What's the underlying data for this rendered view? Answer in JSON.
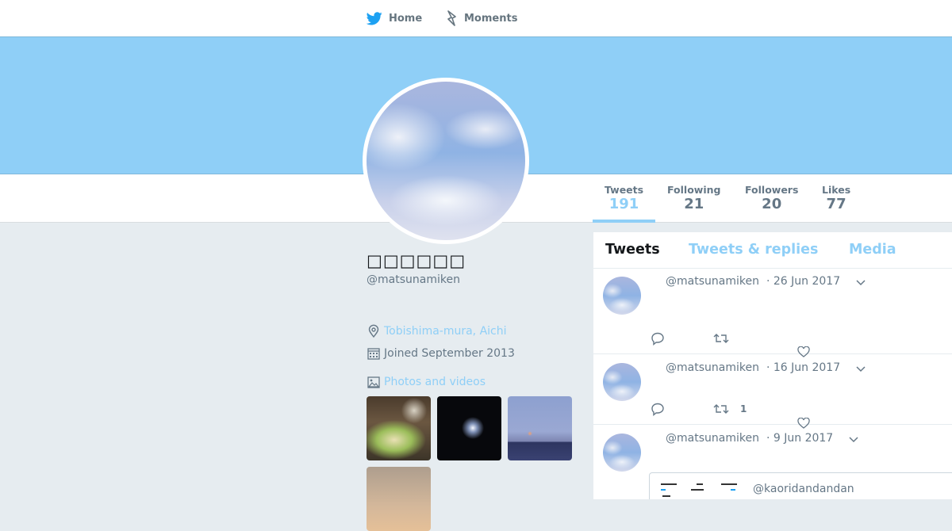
{
  "nav": {
    "home_label": "Home",
    "moments_label": "Moments"
  },
  "colors": {
    "accent": "#8fcff7",
    "banner": "#8fcff7",
    "text_muted": "#657786",
    "background": "#e6ecf0"
  },
  "stats": [
    {
      "label": "Tweets",
      "value": "191"
    },
    {
      "label": "Following",
      "value": "21"
    },
    {
      "label": "Followers",
      "value": "20"
    },
    {
      "label": "Likes",
      "value": "77"
    }
  ],
  "profile": {
    "name": "□□□□□□",
    "handle": "@matsunamiken",
    "location": "Tobishima-mura, Aichi",
    "joined": "Joined September 2013",
    "photos_label": "Photos and videos"
  },
  "timeline": {
    "tabs": [
      "Tweets",
      "Tweets & replies",
      "Media"
    ],
    "tweets": [
      {
        "handle": "@matsunamiken",
        "date": "· 26 Jun 2017",
        "retweets": ""
      },
      {
        "handle": "@matsunamiken",
        "date": "· 16 Jun 2017",
        "retweets": "1"
      },
      {
        "handle": "@matsunamiken",
        "date": "· 9 Jun 2017",
        "retweets": "",
        "quoted_handle": "@kaoridandandan"
      }
    ]
  },
  "icons": {
    "home": "twitter-bird-icon",
    "moments": "lightning-icon",
    "location": "location-pin-icon",
    "calendar": "calendar-icon",
    "photos": "image-icon",
    "reply": "reply-icon",
    "retweet": "retweet-icon",
    "like": "heart-icon",
    "caret": "chevron-down-icon"
  }
}
